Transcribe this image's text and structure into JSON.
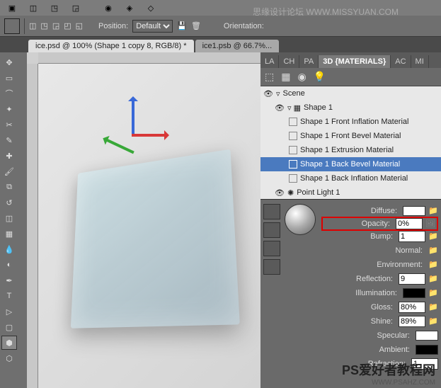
{
  "menubar": {
    "icons": [
      "logo",
      "back",
      "forward",
      "cube",
      "sphere",
      "poly",
      "more"
    ]
  },
  "optbar": {
    "position_label": "Position:",
    "position_value": "Default",
    "orientation_label": "Orientation:"
  },
  "document_tabs": [
    {
      "label": "ice.psd @ 100% (Shape 1 copy 8, RGB/8) *",
      "active": true
    },
    {
      "label": "ice1.psb @ 66.7%...",
      "active": false
    }
  ],
  "panel_tabs": [
    {
      "label": "LA",
      "active": false
    },
    {
      "label": "CH",
      "active": false
    },
    {
      "label": "PA",
      "active": false
    },
    {
      "label": "3D {MATERIALS}",
      "active": true
    },
    {
      "label": "AC",
      "active": false
    },
    {
      "label": "MI",
      "active": false
    }
  ],
  "scene": {
    "root": "Scene",
    "shape": "Shape 1",
    "materials": [
      "Shape 1 Front Inflation Material",
      "Shape 1 Front Bevel Material",
      "Shape 1 Extrusion Material",
      "Shape 1 Back Bevel Material",
      "Shape 1 Back Inflation Material"
    ],
    "selected_index": 3,
    "light": "Point Light 1"
  },
  "materials": {
    "diffuse_label": "Diffuse:",
    "opacity_label": "Opacity:",
    "opacity_value": "0%",
    "bump_label": "Bump:",
    "bump_value": "1",
    "normal_label": "Normal:",
    "environment_label": "Environment:",
    "reflection_label": "Reflection:",
    "reflection_value": "9",
    "illumination_label": "Illumination:",
    "gloss_label": "Gloss:",
    "gloss_value": "80%",
    "shine_label": "Shine:",
    "shine_value": "89%",
    "specular_label": "Specular:",
    "ambient_label": "Ambient:",
    "refraction_label": "Refraction:",
    "refraction_value": "1"
  },
  "watermarks": {
    "top": "思缘设计论坛 WWW.MISSYUAN.COM",
    "bottom_main": "PS爱好者教程网",
    "bottom_url": "WWW.PSAHZ.COM"
  }
}
